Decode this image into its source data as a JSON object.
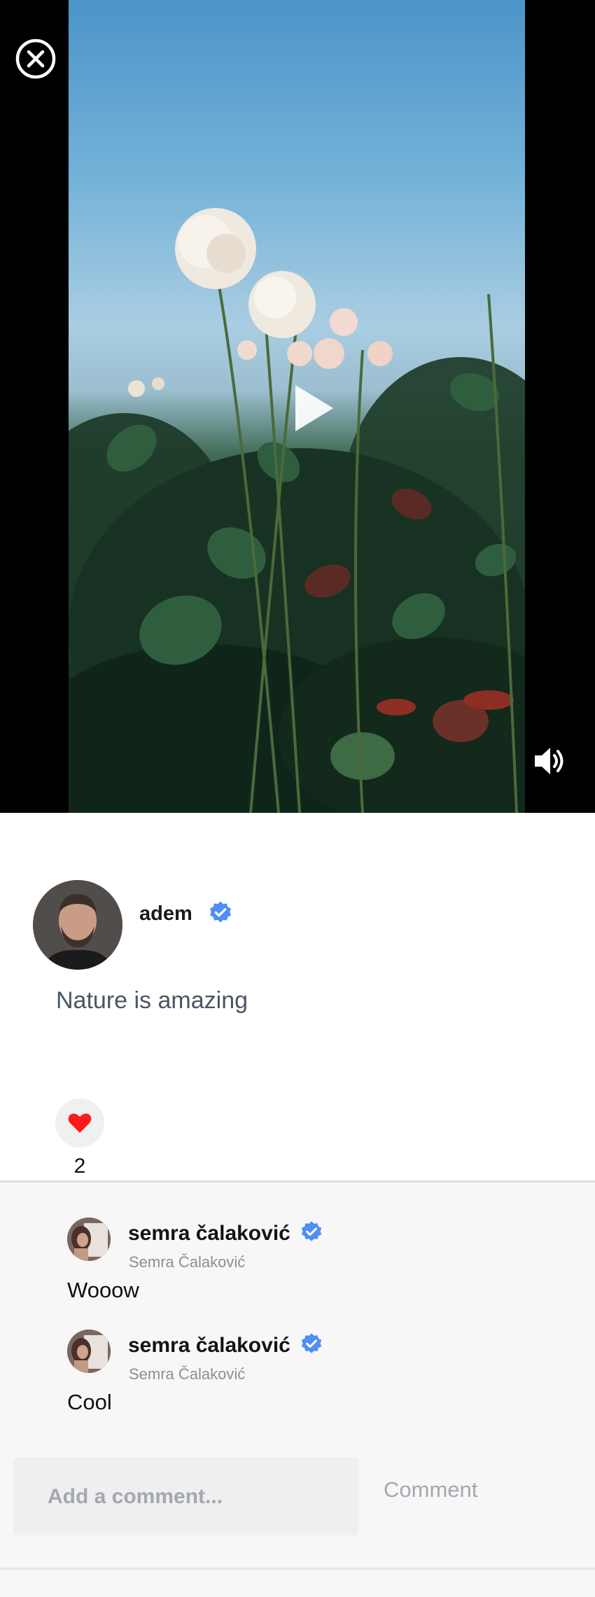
{
  "video": {
    "close_icon": "close-circle-icon",
    "play_icon": "play-icon",
    "volume_icon": "volume-icon"
  },
  "post": {
    "username": "adem",
    "verified_icon": "verified-badge-icon",
    "caption": "Nature is amazing",
    "like_icon": "heart-icon",
    "like_count": "2",
    "accent_color": "#3b82f6",
    "heart_color": "#ff1a1a"
  },
  "comments": [
    {
      "name": "semra čalaković",
      "subtitle": "Semra Čalaković",
      "text": "Wooow"
    },
    {
      "name": "semra čalaković",
      "subtitle": "Semra Čalaković",
      "text": "Cool"
    }
  ],
  "comment_form": {
    "placeholder": "Add a comment...",
    "submit_label": "Comment"
  }
}
